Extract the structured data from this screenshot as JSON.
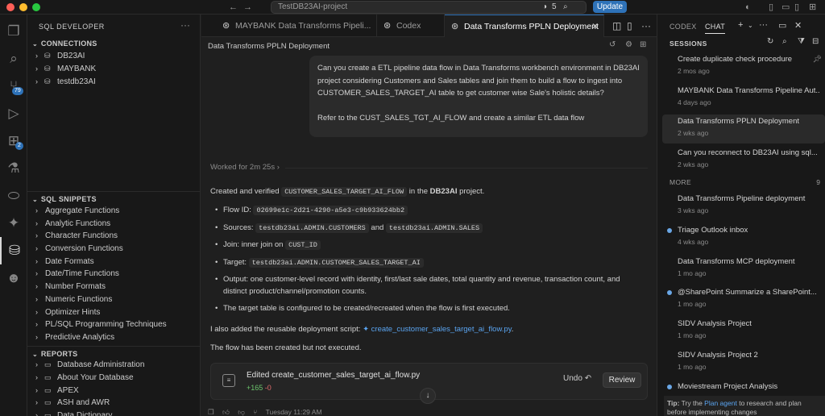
{
  "titlebar": {
    "project_search": "TestDB23AI-project",
    "notification_count": "5",
    "update_label": "Update"
  },
  "activity_bar": {
    "source_control_badge": "79",
    "extensions_badge": "2"
  },
  "sidebar": {
    "title": "SQL DEVELOPER",
    "more": "···",
    "connections_header": "CONNECTIONS",
    "connections": [
      "DB23AI",
      "MAYBANK",
      "testdb23AI"
    ],
    "snippets_header": "SQL SNIPPETS",
    "snippets": [
      "Aggregate Functions",
      "Analytic Functions",
      "Character Functions",
      "Conversion Functions",
      "Date Formats",
      "Date/Time Functions",
      "Number Formats",
      "Numeric Functions",
      "Optimizer Hints",
      "PL/SQL Programming Techniques",
      "Predictive Analytics"
    ],
    "reports_header": "REPORTS",
    "reports": [
      "Database Administration",
      "About Your Database",
      "APEX",
      "ASH and AWR",
      "Data Dictionary"
    ]
  },
  "editor": {
    "tabs": [
      {
        "label": "MAYBANK Data Transforms Pipeli..."
      },
      {
        "label": "Codex"
      },
      {
        "label": "Data Transforms PPLN Deployment"
      }
    ],
    "chat_title": "Data Transforms PPLN Deployment",
    "user_message_p1": "Can you create a ETL pipeline data flow in Data Transforms workbench environment in DB23AI project considering Customers and Sales tables and join them to build a flow to ingest into CUSTOMER_SALES_TARGET_AI table to get customer wise Sale's holistic details?",
    "user_message_p2": "Refer to the CUST_SALES_TGT_AI_FLOW and create a similar ETL data flow",
    "worked_for": "Worked for 2m 25s",
    "resp_intro_pre": "Created and verified",
    "resp_intro_code": "CUSTOMER_SALES_TARGET_AI_FLOW",
    "resp_intro_mid": "in the",
    "resp_intro_bold": "DB23AI",
    "resp_intro_post": "project.",
    "flow_id_label": "Flow ID:",
    "flow_id": "02699e1c-2d21-4290-a5e3-c9b933624bb2",
    "sources_label": "Sources:",
    "source_1": "testdb23ai.ADMIN.CUSTOMERS",
    "sources_and": "and",
    "source_2": "testdb23ai.ADMIN.SALES",
    "join_label": "Join: inner join on",
    "join_key": "CUST_ID",
    "target_label": "Target:",
    "target": "testdb23ai.ADMIN.CUSTOMER_SALES_TARGET_AI",
    "output_line1": "Output: one customer-level record with identity, first/last sale dates, total quantity and revenue, transaction count, and",
    "output_line2": "distinct product/channel/promotion counts.",
    "target_note": "The target table is configured to be created/recreated when the flow is first executed.",
    "script_pre": "I also added the reusable deployment script:",
    "script_link": "create_customer_sales_target_ai_flow.py",
    "script_post": ".",
    "not_executed": "The flow has been created but not executed.",
    "edited_title": "Edited create_customer_sales_target_ai_flow.py",
    "diff_add": "+165",
    "diff_del": "-0",
    "undo_label": "Undo",
    "review_label": "Review",
    "timestamp": "Tuesday 11:29 AM"
  },
  "right_panel": {
    "tab_codex": "CODEX",
    "tab_chat": "CHAT",
    "sessions_label": "SESSIONS",
    "sessions": [
      {
        "title": "Create duplicate check procedure",
        "date": "2 mos ago",
        "dot": false
      },
      {
        "title": "MAYBANK Data Transforms Pipeline Aut...",
        "date": "4 days ago",
        "dot": false
      },
      {
        "title": "Data Transforms PPLN Deployment",
        "date": "2 wks ago",
        "dot": false
      },
      {
        "title": "Can you reconnect to DB23AI using sql...",
        "date": "2 wks ago",
        "dot": false
      }
    ],
    "more_label": "MORE",
    "more_count": "9",
    "more_sessions": [
      {
        "title": "Data Transforms Pipeline deployment",
        "date": "3 wks ago",
        "dot": false
      },
      {
        "title": "Triage Outlook inbox",
        "date": "4 wks ago",
        "dot": true
      },
      {
        "title": "Data Transforms MCP deployment",
        "date": "1 mo ago",
        "dot": false
      },
      {
        "title": "@SharePoint Summarize a SharePoint...",
        "date": "1 mo ago",
        "dot": true
      },
      {
        "title": "SIDV Analysis Project",
        "date": "1 mo ago",
        "dot": false
      },
      {
        "title": "SIDV Analysis Project 2",
        "date": "1 mo ago",
        "dot": false
      },
      {
        "title": "Moviestream Project Analysis",
        "date": "",
        "dot": true
      }
    ],
    "tip_label": "Tip:",
    "tip_pre": "Try the",
    "tip_link": "Plan agent",
    "tip_post": "to research and plan before implementing changes"
  }
}
